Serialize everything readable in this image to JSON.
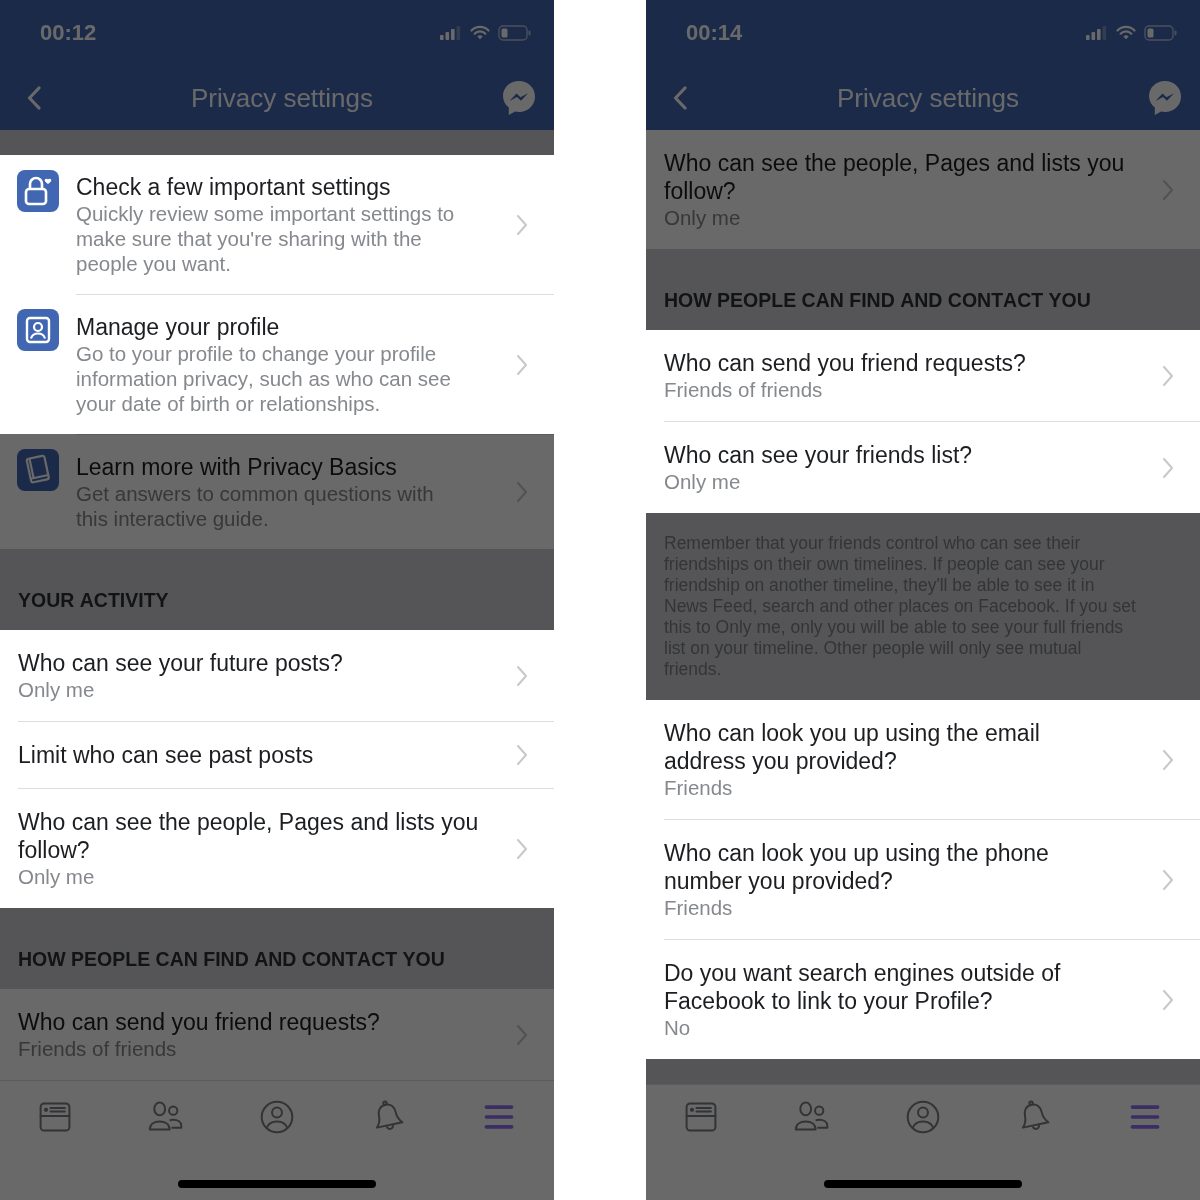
{
  "screens": [
    {
      "top_bar": {
        "dimmed": true,
        "time": "00:12",
        "title": "Privacy settings"
      },
      "items": [
        {
          "kind": "gap",
          "dimmed": true
        },
        {
          "kind": "shortcut",
          "dimmed": false,
          "title": "Check a few important settings",
          "description": "Quickly review some important settings to make sure that you're sharing with the people you want."
        },
        {
          "kind": "shortcut",
          "dimmed": false,
          "title": "Manage your profile",
          "description": "Go to your profile to change your profile information privacy, such as who can see your date of birth or relationships."
        },
        {
          "kind": "shortcut",
          "dimmed": true,
          "title": "Learn more with Privacy Basics",
          "description": "Get answers to common questions with this interactive guide."
        },
        {
          "kind": "header",
          "dimmed": true,
          "text": "YOUR ACTIVITY"
        },
        {
          "kind": "setting",
          "dimmed": false,
          "title": "Who can see your future posts?",
          "value": "Only me"
        },
        {
          "kind": "setting",
          "dimmed": false,
          "title": "Limit who can see past posts"
        },
        {
          "kind": "setting",
          "dimmed": false,
          "title": "Who can see the people, Pages and lists you follow?",
          "value": "Only me"
        },
        {
          "kind": "header",
          "dimmed": true,
          "text": "HOW PEOPLE CAN FIND AND CONTACT YOU"
        },
        {
          "kind": "setting",
          "dimmed": true,
          "title": "Who can send you friend requests?",
          "value": "Friends of friends"
        }
      ],
      "tab_bar": {
        "dimmed": true,
        "tabs": [
          {
            "selected": false
          },
          {
            "selected": false
          },
          {
            "selected": false
          },
          {
            "selected": false
          },
          {
            "selected": true
          }
        ]
      }
    },
    {
      "top_bar": {
        "dimmed": true,
        "time": "00:14",
        "title": "Privacy settings"
      },
      "items": [
        {
          "kind": "setting",
          "dimmed": true,
          "title": "Who can see the people, Pages and lists you follow?",
          "value": "Only me"
        },
        {
          "kind": "header",
          "dimmed": true,
          "text": "HOW PEOPLE CAN FIND AND CONTACT YOU"
        },
        {
          "kind": "setting",
          "dimmed": false,
          "title": "Who can send you friend requests?",
          "value": "Friends of friends"
        },
        {
          "kind": "setting",
          "dimmed": false,
          "title": "Who can see your friends list?",
          "value": "Only me"
        },
        {
          "kind": "note",
          "dimmed": true,
          "text": "Remember that your friends control who can see their friendships on their own timelines. If people can see your friendship on another timeline, they'll be able to see it in News Feed, search and other places on Facebook. If you set this to Only me, only you will be able to see your full friends list on your timeline. Other people will only see mutual friends."
        },
        {
          "kind": "setting",
          "dimmed": false,
          "title": "Who can look you up using the email address you provided?",
          "value": "Friends"
        },
        {
          "kind": "setting",
          "dimmed": false,
          "title": "Who can look you up using the phone number you provided?",
          "value": "Friends"
        },
        {
          "kind": "setting",
          "dimmed": false,
          "title": "Do you want search engines outside of Facebook to link to your Profile?",
          "value": "No"
        },
        {
          "kind": "gap",
          "dimmed": true
        }
      ],
      "tab_bar": {
        "dimmed": true,
        "tabs": [
          {
            "selected": false
          },
          {
            "selected": false
          },
          {
            "selected": false
          },
          {
            "selected": false
          },
          {
            "selected": true
          }
        ]
      }
    }
  ]
}
